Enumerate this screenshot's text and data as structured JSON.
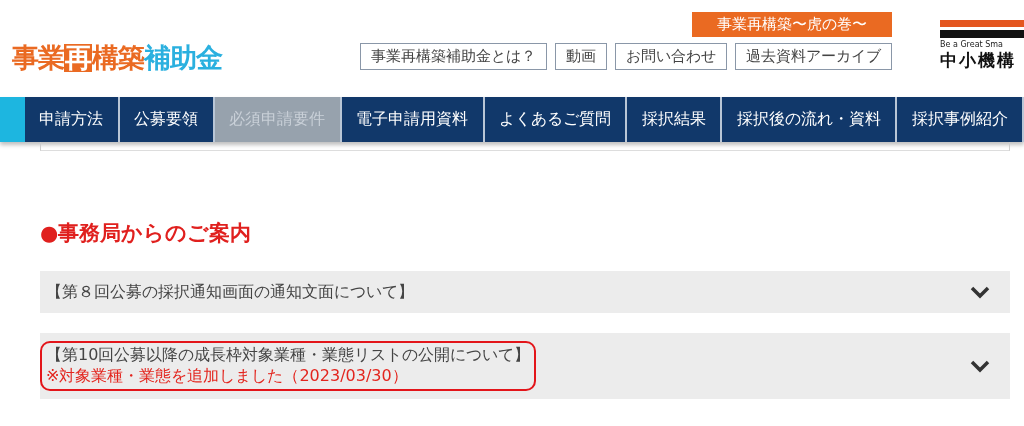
{
  "header": {
    "logo": {
      "prefix": "事業",
      "boxed": "再",
      "middle": "構築",
      "suffix": "補助金"
    },
    "badge": "事業再構築〜虎の巻〜",
    "links": [
      "事業再構築補助金とは？",
      "動画",
      "お問い合わせ",
      "過去資料アーカイブ"
    ],
    "org_logo": {
      "tagline": "Be a Great Sma",
      "name": "中小機構"
    }
  },
  "nav": [
    {
      "label": "申請方法",
      "selected": false
    },
    {
      "label": "公募要領",
      "selected": false
    },
    {
      "label": "必須申請要件",
      "selected": true
    },
    {
      "label": "電子申請用資料",
      "selected": false
    },
    {
      "label": "よくあるご質問",
      "selected": false
    },
    {
      "label": "採択結果",
      "selected": false
    },
    {
      "label": "採択後の流れ・資料",
      "selected": false
    },
    {
      "label": "採択事例紹介",
      "selected": false
    }
  ],
  "section": {
    "heading": "●事務局からのご案内",
    "items": [
      {
        "title": "【第８回公募の採択通知画面の通知文面について】",
        "highlighted": false
      },
      {
        "title": "【第10回公募以降の成長枠対象業種・業態リストの公開について】",
        "note": "※対象業種・業態を追加しました（2023/03/30）",
        "highlighted": true
      }
    ]
  }
}
